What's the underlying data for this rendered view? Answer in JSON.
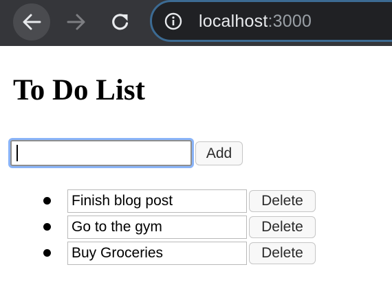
{
  "browser": {
    "address": {
      "host": "localhost",
      "port": ":3000"
    },
    "icons": {
      "back": "arrow-left-icon",
      "forward": "arrow-right-icon",
      "reload": "reload-icon",
      "info": "info-icon"
    }
  },
  "page": {
    "title": "To Do List",
    "new_item": {
      "value": "",
      "placeholder": ""
    },
    "add_label": "Add",
    "todos": [
      {
        "text": "Finish blog post",
        "delete_label": "Delete"
      },
      {
        "text": "Go to the gym",
        "delete_label": "Delete"
      },
      {
        "text": "Buy Groceries",
        "delete_label": "Delete"
      }
    ]
  },
  "colors": {
    "chrome_bg": "#35363a",
    "omnibox_bg": "#202124",
    "omnibox_border": "#3c6b93",
    "focus_ring": "#8ab4f8"
  }
}
